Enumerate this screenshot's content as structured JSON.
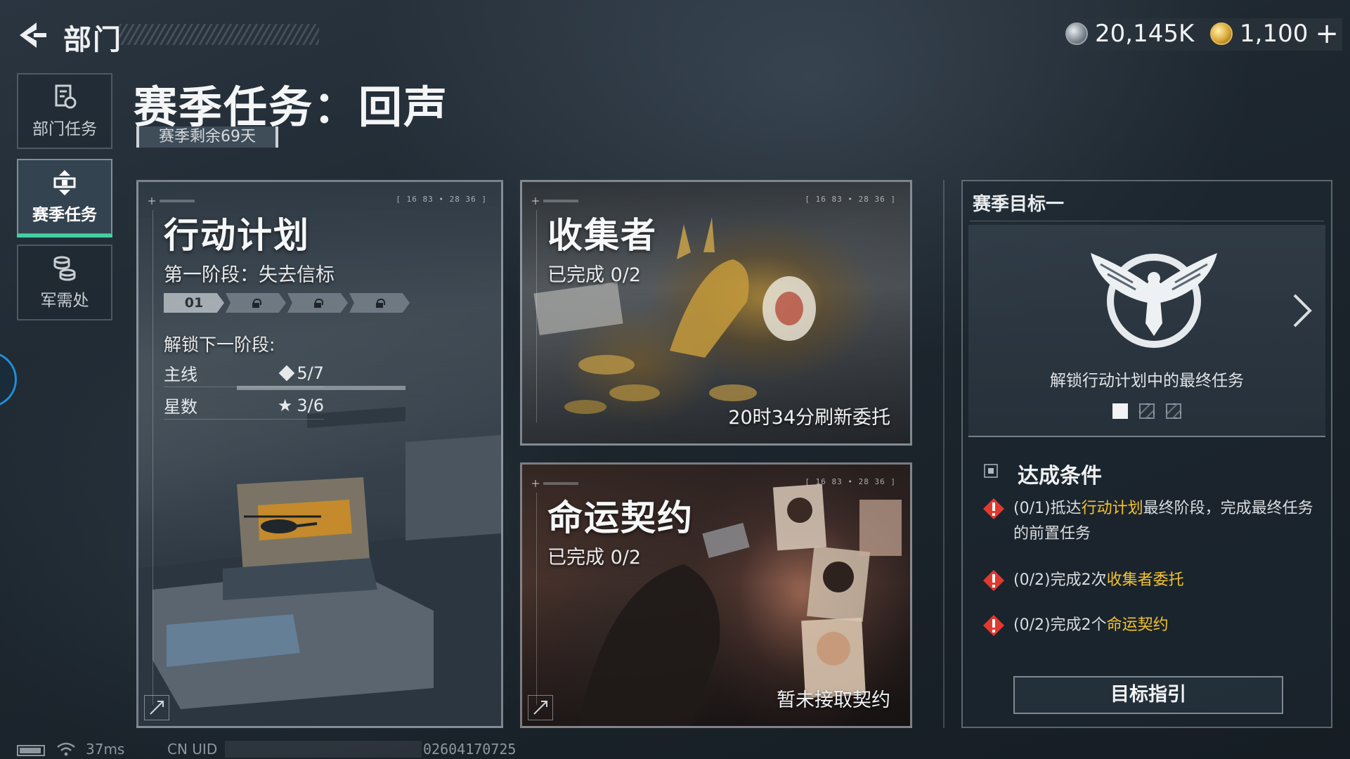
{
  "header": {
    "title": "部门",
    "currencies": [
      {
        "icon": "silver-coin-icon",
        "value": "20,145K"
      },
      {
        "icon": "gold-coin-icon",
        "value": "1,100"
      }
    ],
    "add_label": "+"
  },
  "sidebar": {
    "items": [
      {
        "label": "部门任务",
        "icon": "department-task-icon",
        "active": false
      },
      {
        "label": "赛季任务",
        "icon": "season-task-icon",
        "active": true
      },
      {
        "label": "军需处",
        "icon": "quartermaster-icon",
        "active": false
      }
    ]
  },
  "main": {
    "title": "赛季任务：回声",
    "days_left": "赛季剩余69天"
  },
  "cards": {
    "plan": {
      "corner_tag": "[ 16 83 • 28 36 ]",
      "title": "行动计划",
      "stage": "第一阶段：失去信标",
      "stages": [
        "01",
        "locked",
        "locked",
        "locked"
      ],
      "unlock_label": "解锁下一阶段:",
      "rows": [
        {
          "label": "主线",
          "icon": "diamond-icon",
          "value": "5/7"
        },
        {
          "label": "星数",
          "icon": "star-icon",
          "value": "3/6"
        }
      ]
    },
    "collector": {
      "corner_tag": "[ 16 83 • 28 36 ]",
      "title": "收集者",
      "progress": "已完成 0/2",
      "note": "20时34分刷新委托"
    },
    "fate": {
      "corner_tag": "[ 16 83 • 28 36 ]",
      "title": "命运契约",
      "progress": "已完成 0/2",
      "note": "暂未接取契约"
    }
  },
  "goal": {
    "header": "赛季目标一",
    "unlock_text": "解锁行动计划中的最终任务",
    "pages": 3,
    "active_page": 1,
    "conditions_title": "达成条件",
    "conditions": [
      {
        "prefix": "(0/1)抵达",
        "highlight": "行动计划",
        "suffix": "最终阶段，完成最终任务的前置任务"
      },
      {
        "prefix": "(0/2)完成2次",
        "highlight": "收集者委托",
        "suffix": ""
      },
      {
        "prefix": "(0/2)完成2个",
        "highlight": "命运契约",
        "suffix": ""
      }
    ],
    "guide_button": "目标指引",
    "colors": {
      "highlight": "#f2c230",
      "warning": "#e03a2f",
      "active_tab": "#3fd1a0"
    }
  },
  "status": {
    "ping": "37ms",
    "uid_label": "CN UID",
    "uid_value": "02604170725"
  }
}
